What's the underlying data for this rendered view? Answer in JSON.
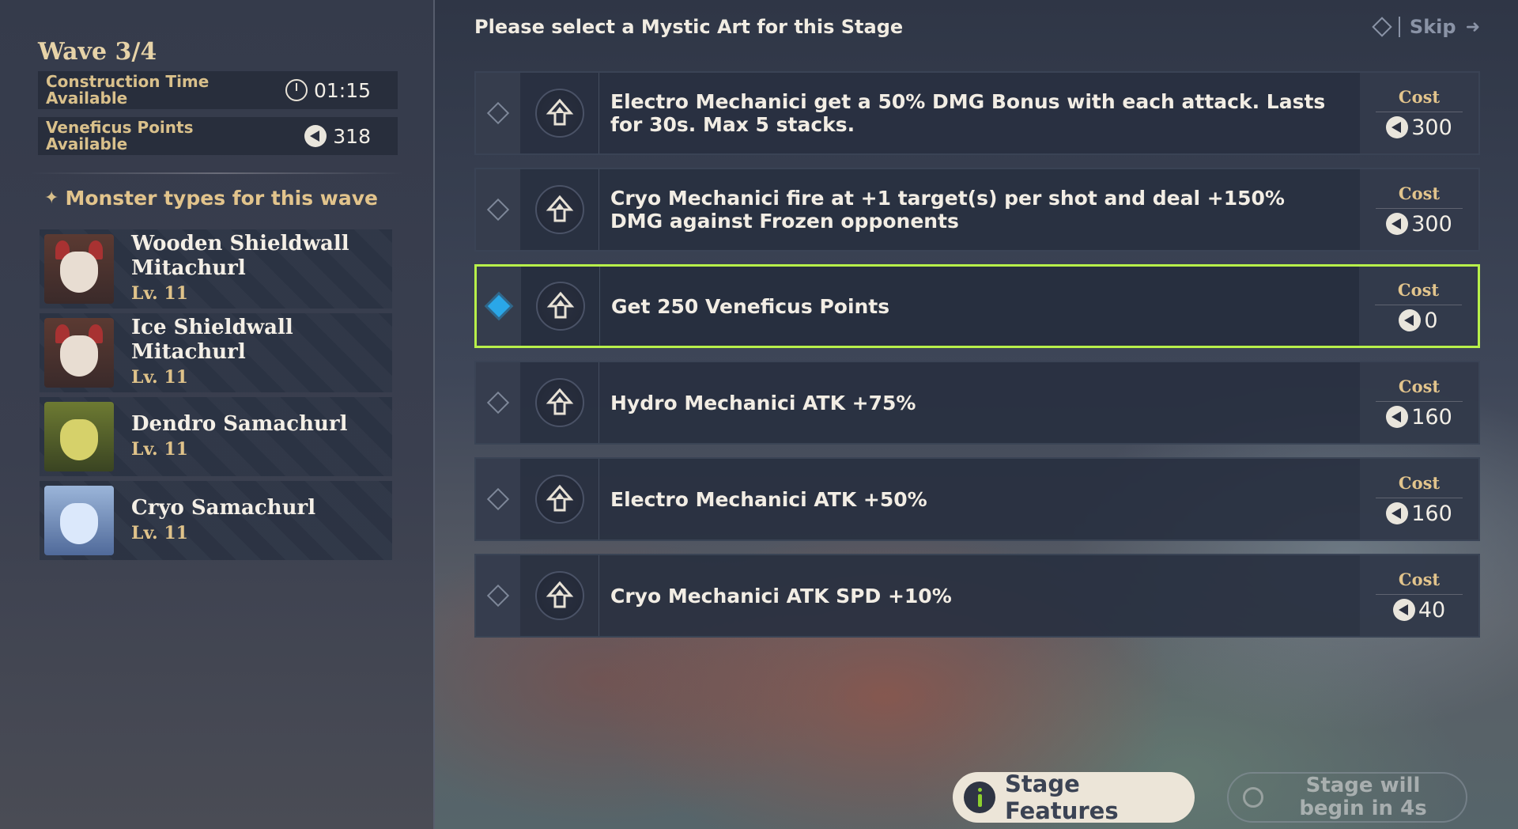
{
  "wave": {
    "title": "Wave 3/4"
  },
  "info": {
    "construction_label": "Construction Time Available",
    "construction_value": "01:15",
    "points_label": "Veneficus Points Available",
    "points_value": "318"
  },
  "monsters": {
    "header": "Monster types for this wave",
    "items": [
      {
        "name": "Wooden Shieldwall Mitachurl",
        "level": "Lv. 11",
        "portrait": "mitachurl"
      },
      {
        "name": "Ice Shieldwall Mitachurl",
        "level": "Lv. 11",
        "portrait": "mitachurl"
      },
      {
        "name": "Dendro Samachurl",
        "level": "Lv. 11",
        "portrait": "dendro"
      },
      {
        "name": "Cryo Samachurl",
        "level": "Lv. 11",
        "portrait": "cryo"
      }
    ]
  },
  "prompt": "Please select a Mystic Art for this Stage",
  "skip_label": "Skip",
  "arts": [
    {
      "desc": "Electro Mechanici get a 50% DMG Bonus with each attack. Lasts for 30s. Max 5 stacks.",
      "cost_label": "Cost",
      "cost": "300",
      "selected": false
    },
    {
      "desc": "Cryo Mechanici fire at +1 target(s) per shot and deal +150% DMG against Frozen opponents",
      "cost_label": "Cost",
      "cost": "300",
      "selected": false
    },
    {
      "desc": "Get 250 Veneficus Points",
      "cost_label": "Cost",
      "cost": "0",
      "selected": true
    },
    {
      "desc": "Hydro Mechanici ATK +75%",
      "cost_label": "Cost",
      "cost": "160",
      "selected": false
    },
    {
      "desc": "Electro Mechanici ATK +50%",
      "cost_label": "Cost",
      "cost": "160",
      "selected": false
    },
    {
      "desc": "Cryo Mechanici ATK SPD +10%",
      "cost_label": "Cost",
      "cost": "40",
      "selected": false
    }
  ],
  "stage_features_label": "Stage Features",
  "stage_begin_label": "Stage will begin in 4s",
  "colors": {
    "selection": "#b8f04a",
    "selected_marker": "#2aa7e8",
    "gold": "#e2c48c"
  },
  "icons": {
    "art": "up-arrow-icon",
    "currency": "veneficus-coin-icon",
    "time": "clock-icon"
  }
}
